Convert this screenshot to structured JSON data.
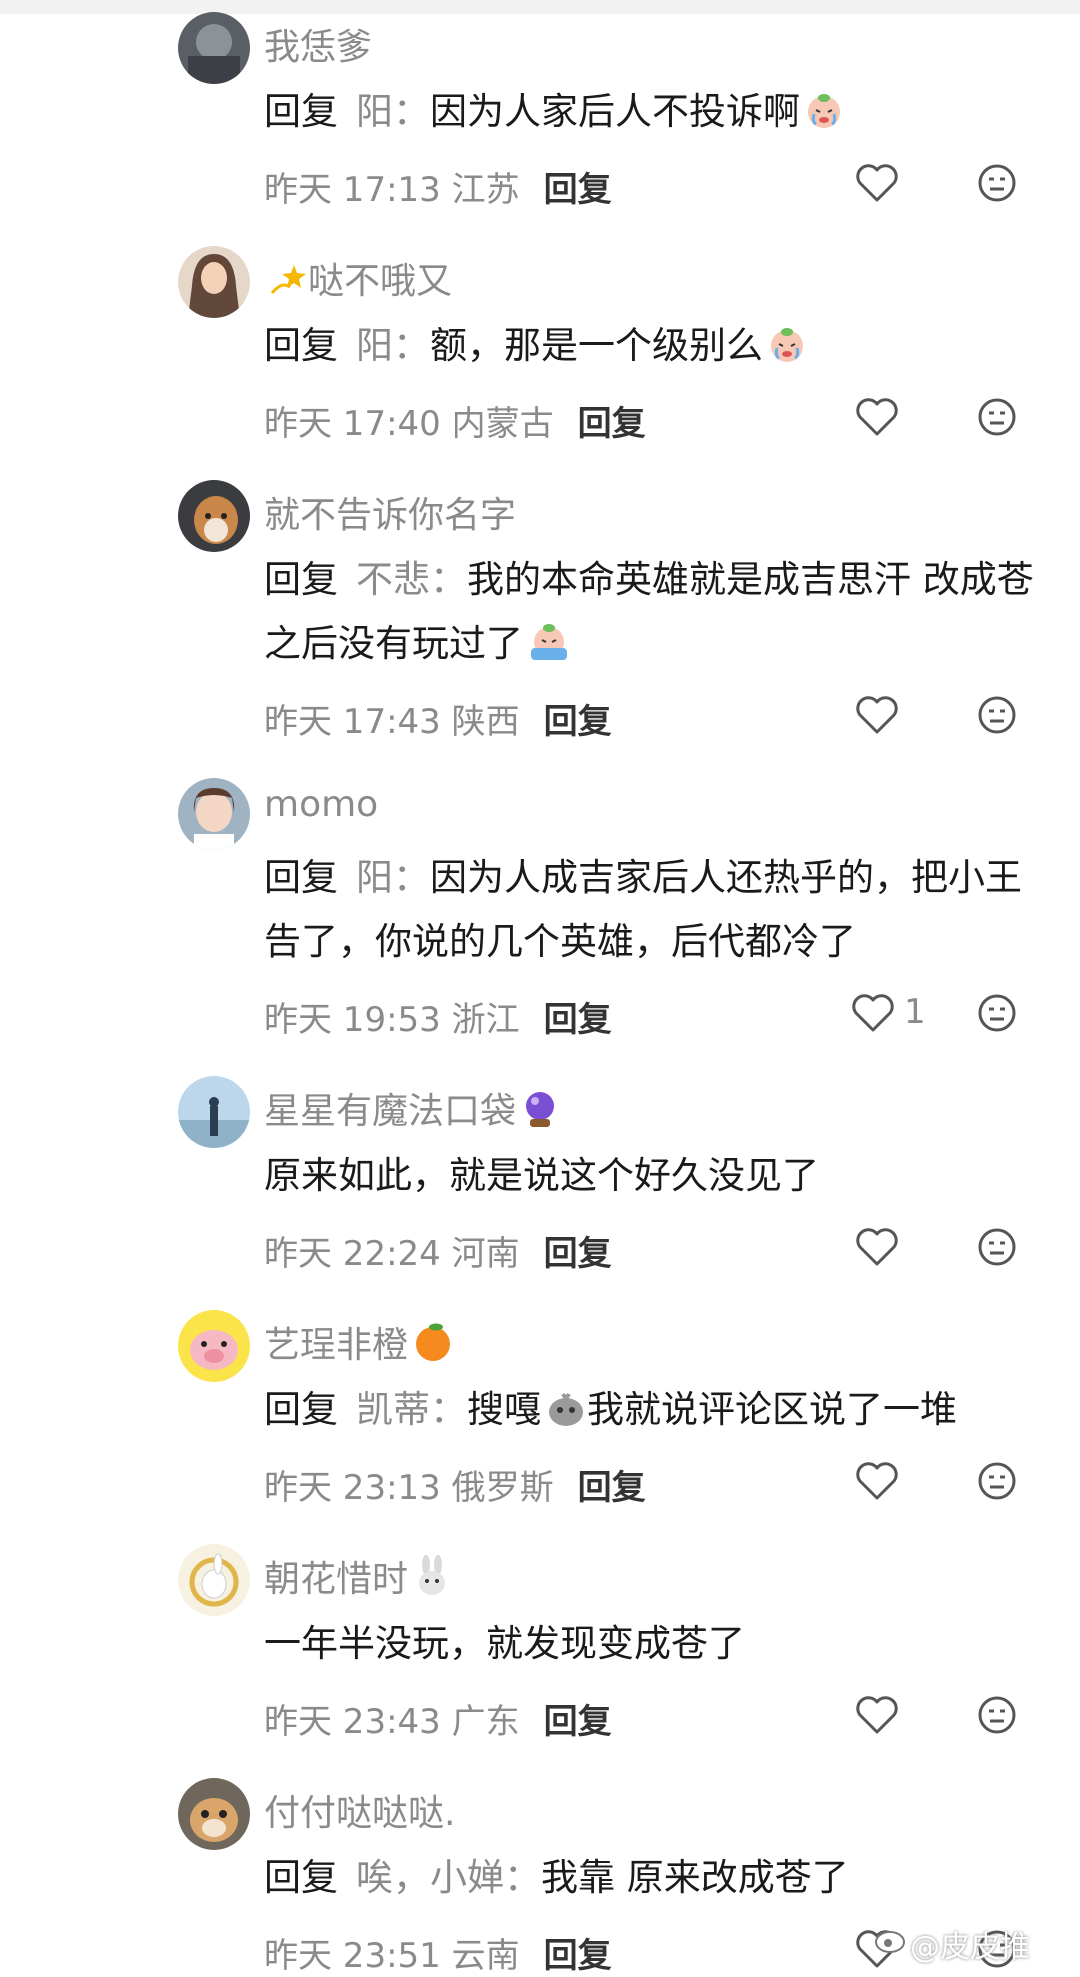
{
  "comments": [
    {
      "username": "我恁爹",
      "reply_prefix": "回复",
      "reply_target": "阳：",
      "text": "因为人家后人不投诉啊",
      "time": "昨天 17:13",
      "location": "江苏",
      "reply_label": "回复",
      "likes": ""
    },
    {
      "username": "哒不哦又",
      "reply_prefix": "回复",
      "reply_target": "阳：",
      "text": "额，那是一个级别么",
      "time": "昨天 17:40",
      "location": "内蒙古",
      "reply_label": "回复",
      "likes": ""
    },
    {
      "username": "就不告诉你名字",
      "reply_prefix": "回复",
      "reply_target": "不悲：",
      "text": "我的本命英雄就是成吉思汗 改成苍之后没有玩过了",
      "time": "昨天 17:43",
      "location": "陕西",
      "reply_label": "回复",
      "likes": ""
    },
    {
      "username": "momo",
      "reply_prefix": "回复",
      "reply_target": "阳：",
      "text": "因为人成吉家后人还热乎的，把小王告了，你说的几个英雄，后代都冷了",
      "time": "昨天 19:53",
      "location": "浙江",
      "reply_label": "回复",
      "likes": "1"
    },
    {
      "username": "星星有魔法口袋",
      "reply_prefix": "",
      "reply_target": "",
      "text": "原来如此，就是说这个好久没见了",
      "time": "昨天 22:24",
      "location": "河南",
      "reply_label": "回复",
      "likes": ""
    },
    {
      "username": "艺珵非橙",
      "reply_prefix": "回复",
      "reply_target": "凯蒂：",
      "text": "搜嘎",
      "text2": "我就说评论区说了一堆",
      "time": "昨天 23:13",
      "location": "俄罗斯",
      "reply_label": "回复",
      "likes": ""
    },
    {
      "username": "朝花惜时",
      "reply_prefix": "",
      "reply_target": "",
      "text": "一年半没玩，就发现变成苍了",
      "time": "昨天 23:43",
      "location": "广东",
      "reply_label": "回复",
      "likes": ""
    },
    {
      "username": "付付哒哒哒.",
      "reply_prefix": "回复",
      "reply_target": "唉，小婵：",
      "text": "我靠 原来改成苍了",
      "time": "昨天 23:51",
      "location": "云南",
      "reply_label": "回复",
      "likes": ""
    }
  ],
  "watermark": "@皮皮推",
  "icons": {
    "like": "heart-outline-icon",
    "dislike": "neutral-face-icon",
    "emoji_cry": "crying-face-emoji",
    "emoji_sparkle": "dizzy-star-emoji",
    "emoji_ball": "crystal-ball-emoji",
    "emoji_orange": "tangerine-emoji",
    "emoji_rabbit": "rabbit-emoji",
    "emoji_ghost": "gray-blob-emoji"
  },
  "colors": {
    "text": "#1a1a1a",
    "muted": "#8a8a8a",
    "background": "#ffffff"
  }
}
